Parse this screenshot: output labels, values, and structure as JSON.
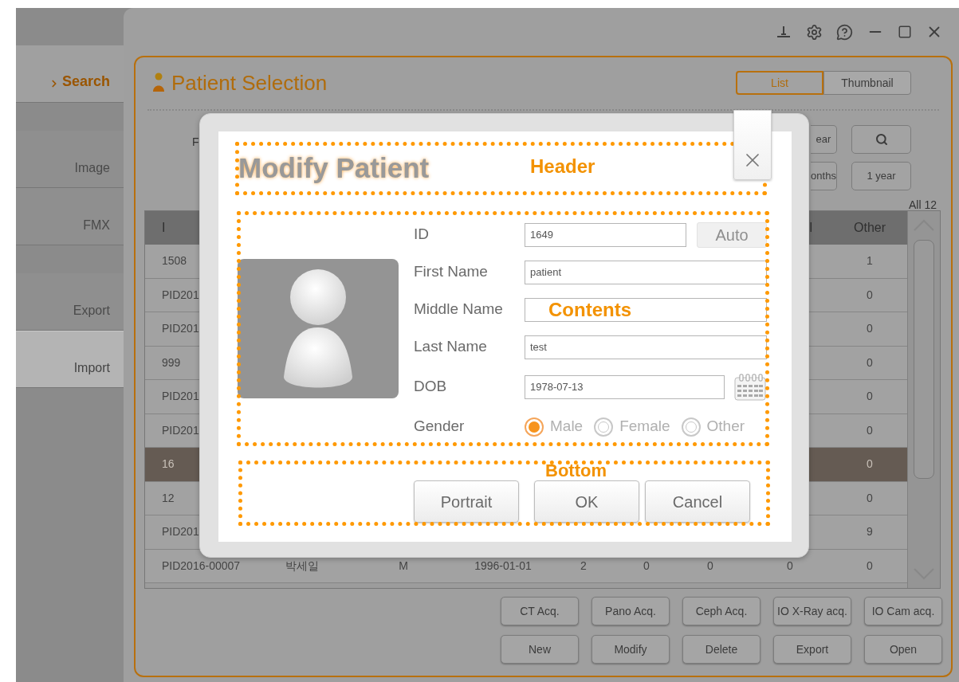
{
  "sidebar": {
    "groups": [
      {
        "items": [
          {
            "label": "Search",
            "selected": true,
            "highlighted": false
          }
        ]
      },
      {
        "items": [
          {
            "label": "Image",
            "selected": false,
            "highlighted": false
          },
          {
            "label": "FMX",
            "selected": false,
            "highlighted": false
          }
        ]
      },
      {
        "items": [
          {
            "label": "Export",
            "selected": false,
            "highlighted": false
          },
          {
            "label": "Import",
            "selected": false,
            "highlighted": true
          }
        ]
      }
    ]
  },
  "panel": {
    "title": "Patient Selection",
    "view_toggle": [
      {
        "label": "List",
        "selected": true
      },
      {
        "label": "Thumbnail",
        "selected": false
      }
    ],
    "filter_label": "F",
    "filter_buttons": [
      {
        "kind": "text",
        "label": "ear"
      },
      {
        "kind": "search"
      },
      {
        "kind": "text",
        "label": "onths"
      },
      {
        "kind": "text",
        "label": "1 year"
      }
    ],
    "count": "All 12",
    "table": {
      "header": {
        "id": "I",
        "column_8": "l",
        "other": "Other"
      },
      "rows": [
        {
          "selected": false,
          "id": "1508",
          "other": "1"
        },
        {
          "selected": false,
          "id": "PID201",
          "other": "0"
        },
        {
          "selected": false,
          "id": "PID201",
          "other": "0"
        },
        {
          "selected": false,
          "id": "999",
          "other": "0"
        },
        {
          "selected": false,
          "id": "PID201",
          "other": "0"
        },
        {
          "selected": false,
          "id": "PID201",
          "other": "0"
        },
        {
          "selected": true,
          "id": "16",
          "other": "0"
        },
        {
          "selected": false,
          "id": "12",
          "other": "0"
        },
        {
          "selected": false,
          "id": "PID201",
          "other": "9"
        },
        {
          "selected": false,
          "id": "PID2016-00007",
          "name": "박세일",
          "sex": "M",
          "dob": "1996-01-01",
          "column_5": "2",
          "column_6": "0",
          "column_7": "0",
          "column_8": "0",
          "other": "0"
        }
      ]
    },
    "action_rows": [
      {
        "buttons": [
          "CT Acq.",
          "Pano Acq.",
          "Ceph Acq.",
          "IO X-Ray acq.",
          "IO Cam acq."
        ]
      },
      {
        "buttons": [
          "New",
          "Modify",
          "Delete",
          "Export",
          "Open"
        ]
      }
    ]
  },
  "dialog": {
    "title": "Modify Patient",
    "header_annotation": "Header",
    "contents_annotation": "Contents",
    "bottom_annotation": "Bottom",
    "fields": [
      {
        "kind": "text_auto",
        "label": "ID",
        "value": "1649",
        "button": {
          "label": "Auto",
          "disabled": true
        }
      },
      {
        "kind": "text",
        "label": "First Name",
        "value": "patient"
      },
      {
        "kind": "text",
        "label": "Middle Name"
      },
      {
        "kind": "text",
        "label": "Last Name",
        "value": "test"
      },
      {
        "kind": "date",
        "label": "DOB",
        "value": "1978-07-13"
      },
      {
        "kind": "radio",
        "label": "Gender",
        "options": [
          {
            "label": "Male",
            "selected": true
          },
          {
            "label": "Female",
            "selected": false
          },
          {
            "label": "Other",
            "selected": false
          }
        ]
      }
    ],
    "buttons": [
      "Portrait",
      "OK",
      "Cancel"
    ]
  }
}
